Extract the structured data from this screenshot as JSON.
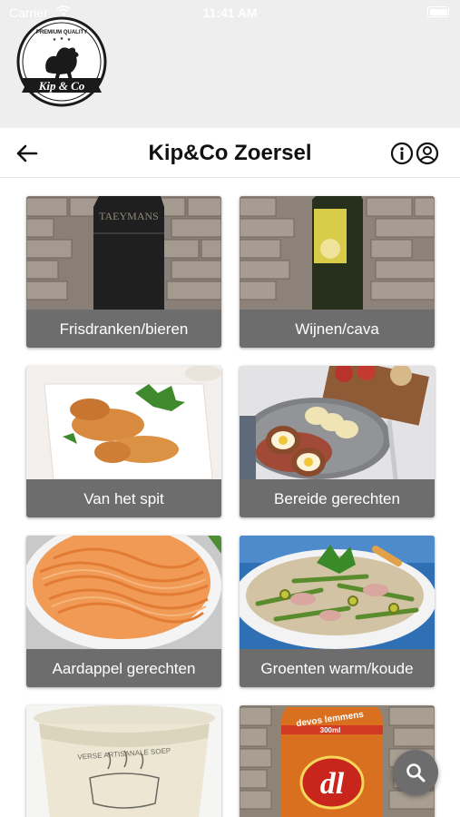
{
  "status_bar": {
    "carrier": "Carrier",
    "time": "11:41 AM"
  },
  "brand": {
    "name": "Kip & Co",
    "tagline": "PREMIUM QUALITY"
  },
  "nav": {
    "title": "Kip&Co Zoersel",
    "back_icon": "arrow-left-icon",
    "info_icon": "info-icon",
    "account_icon": "user-circle-icon"
  },
  "categories": [
    {
      "label": "Frisdranken/bieren",
      "image": "beer-bottle",
      "bottle_label_text": "TAEYMANS"
    },
    {
      "label": "Wijnen/cava",
      "image": "wine-bottle"
    },
    {
      "label": "Van het spit",
      "image": "chicken-wings"
    },
    {
      "label": "Bereide gerechten",
      "image": "scotch-eggs-plate"
    },
    {
      "label": "Aardappel gerechten",
      "image": "mashed-potatoes"
    },
    {
      "label": "Groenten warm/koude",
      "image": "salad-bowl"
    },
    {
      "label": "",
      "image": "soup-container",
      "container_text": "VERSE ARTISANALE SOEP"
    },
    {
      "label": "",
      "image": "sauce-jar",
      "jar_brand": "devos lemmens",
      "jar_volume": "300ml",
      "jar_logo": "dl"
    }
  ],
  "search_fab": {
    "icon": "search-icon"
  },
  "colors": {
    "label_bg": "#6d6d6d",
    "header_bg": "#eeeeee",
    "fab_bg": "#6d6d6d"
  }
}
